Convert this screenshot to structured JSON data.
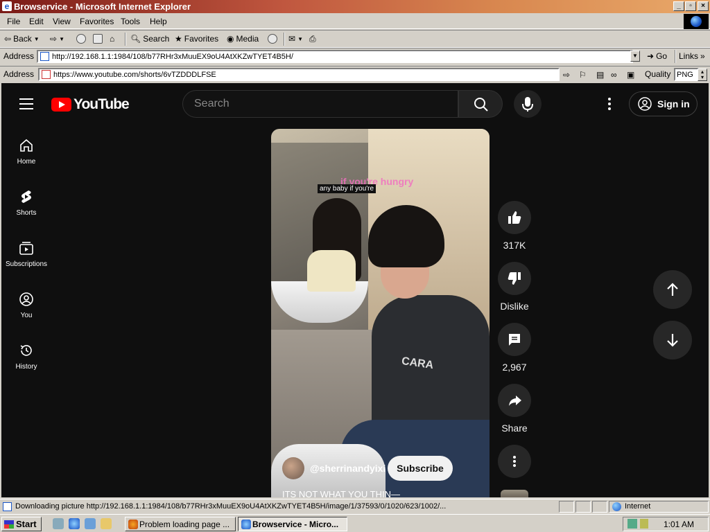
{
  "window": {
    "title": "Browservice - Microsoft Internet Explorer"
  },
  "menu": [
    "File",
    "Edit",
    "View",
    "Favorites",
    "Tools",
    "Help"
  ],
  "toolbar": {
    "back": "Back",
    "search": "Search",
    "favorites": "Favorites",
    "media": "Media"
  },
  "address1": {
    "label": "Address",
    "url": "http://192.168.1.1:1984/108/b77RHr3xMuuEX9oU4AtXKZwTYET4B5H/",
    "go": "Go",
    "links": "Links"
  },
  "address2": {
    "label": "Address",
    "url": "https://www.youtube.com/shorts/6vTZDDDLFSE",
    "quality_label": "Quality",
    "quality_value": "PNG"
  },
  "youtube": {
    "logo": "YouTube",
    "search_placeholder": "Search",
    "sign_in": "Sign in",
    "nav": [
      {
        "label": "Home",
        "icon": "home-icon"
      },
      {
        "label": "Shorts",
        "icon": "shorts-icon"
      },
      {
        "label": "Subscriptions",
        "icon": "subscriptions-icon"
      },
      {
        "label": "You",
        "icon": "you-icon"
      },
      {
        "label": "History",
        "icon": "history-icon"
      }
    ]
  },
  "short": {
    "caption_pink": "if you're hungry",
    "caption_box": "any baby if you're",
    "shirt_text": "CARA",
    "channel": "@sherrinandyixi",
    "subscribe": "Subscribe",
    "title": "ITS NOT WHAT YOU THIN—",
    "likes": "317K",
    "dislike": "Dislike",
    "comments": "2,967",
    "share": "Share"
  },
  "status": {
    "text": "Downloading picture http://192.168.1.1:1984/108/b77RHr3xMuuEX9oU4AtXKZwTYET4B5H/image/1/37593/0/1020/623/1002/...",
    "zone": "Internet"
  },
  "taskbar": {
    "start": "Start",
    "tasks": [
      "Problem loading page ...",
      "Browservice - Micro..."
    ],
    "clock": "1:01 AM"
  },
  "colors": {
    "yt_red": "#ff0000",
    "yt_bg": "#0f0f0f",
    "title_gradient_start": "#7a1a16"
  }
}
